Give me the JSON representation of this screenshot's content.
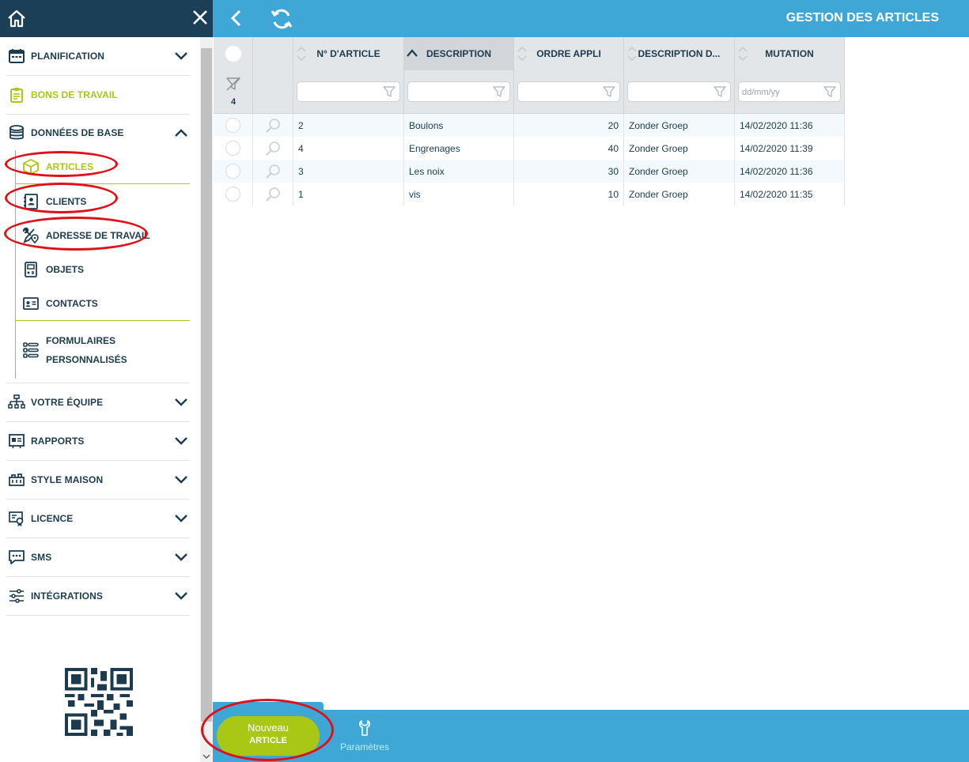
{
  "header": {
    "title": "GESTION DES ARTICLES"
  },
  "sidebar": {
    "items": [
      {
        "label": "PLANIFICATION",
        "icon": "calendar-icon"
      },
      {
        "label": "BONS DE TRAVAIL",
        "icon": "clipboard-icon"
      },
      {
        "label": "DONNÉES DE BASE",
        "icon": "database-icon"
      }
    ],
    "subitems": [
      {
        "label": "ARTICLES",
        "icon": "box-icon"
      },
      {
        "label": "CLIENTS",
        "icon": "address-book-icon"
      },
      {
        "label": "ADRESSE DE TRAVAIL",
        "icon": "tools-location-icon"
      },
      {
        "label": "OBJETS",
        "icon": "device-icon"
      },
      {
        "label": "CONTACTS",
        "icon": "contact-card-icon"
      },
      {
        "label": "FORMULAIRES PERSONNALISÉS",
        "icon": "form-list-icon"
      }
    ],
    "items2": [
      {
        "label": "VOTRE ÉQUIPE",
        "icon": "org-chart-icon"
      },
      {
        "label": "RAPPORTS",
        "icon": "report-icon"
      },
      {
        "label": "STYLE MAISON",
        "icon": "style-icon"
      },
      {
        "label": "LICENCE",
        "icon": "license-icon"
      },
      {
        "label": "SMS",
        "icon": "chat-icon"
      },
      {
        "label": "INTÉGRATIONS",
        "icon": "sliders-icon"
      }
    ]
  },
  "table": {
    "columns": [
      "N° D'ARTICLE",
      "DESCRIPTION",
      "ORDRE APPLI",
      "DESCRIPTION D...",
      "MUTATION"
    ],
    "filter_count": "4",
    "date_placeholder": "dd/mm/yy",
    "rows": [
      {
        "num": "2",
        "description": "Boulons",
        "ordre": "20",
        "groupe": "Zonder Groep",
        "mutation": "14/02/2020 11:36"
      },
      {
        "num": "4",
        "description": "Engrenages",
        "ordre": "40",
        "groupe": "Zonder Groep",
        "mutation": "14/02/2020 11:39"
      },
      {
        "num": "3",
        "description": "Les noix",
        "ordre": "30",
        "groupe": "Zonder Groep",
        "mutation": "14/02/2020 11:36"
      },
      {
        "num": "1",
        "description": "vis",
        "ordre": "10",
        "groupe": "Zonder Groep",
        "mutation": "14/02/2020 11:35"
      }
    ]
  },
  "footer": {
    "new_line1": "Nouveau",
    "new_line2": "ARTICLE",
    "params_label": "Paramètres"
  },
  "colors": {
    "sidebar_dark": "#1b3f56",
    "topbar": "#3fa7d6",
    "accent_green": "#a9c715",
    "annotation_red": "#e0101b"
  }
}
